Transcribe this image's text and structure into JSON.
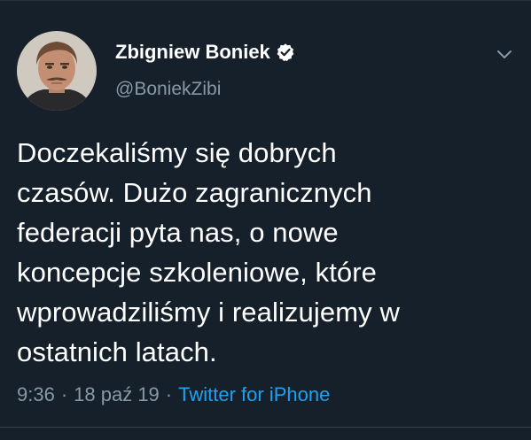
{
  "tweet": {
    "author": {
      "display_name": "Zbigniew Boniek",
      "handle": "@BoniekZibi",
      "verified": true
    },
    "text": "Doczekaliśmy się dobrych\nczasów. Dużo zagranicznych\nfederacji pyta nas, o nowe\nkoncepcje szkoleniowe, które\nwprowadziliśmy i realizujemy w\nostatnich latach.",
    "time": "9:36",
    "separator": "·",
    "date": "18 paź 19",
    "source": "Twitter for iPhone"
  },
  "colors": {
    "background": "#15202b",
    "text": "#ffffff",
    "secondary": "#8899a6",
    "link": "#1da1f2"
  },
  "icons": {
    "verified": "verified-badge-icon",
    "menu": "chevron-down-icon"
  }
}
